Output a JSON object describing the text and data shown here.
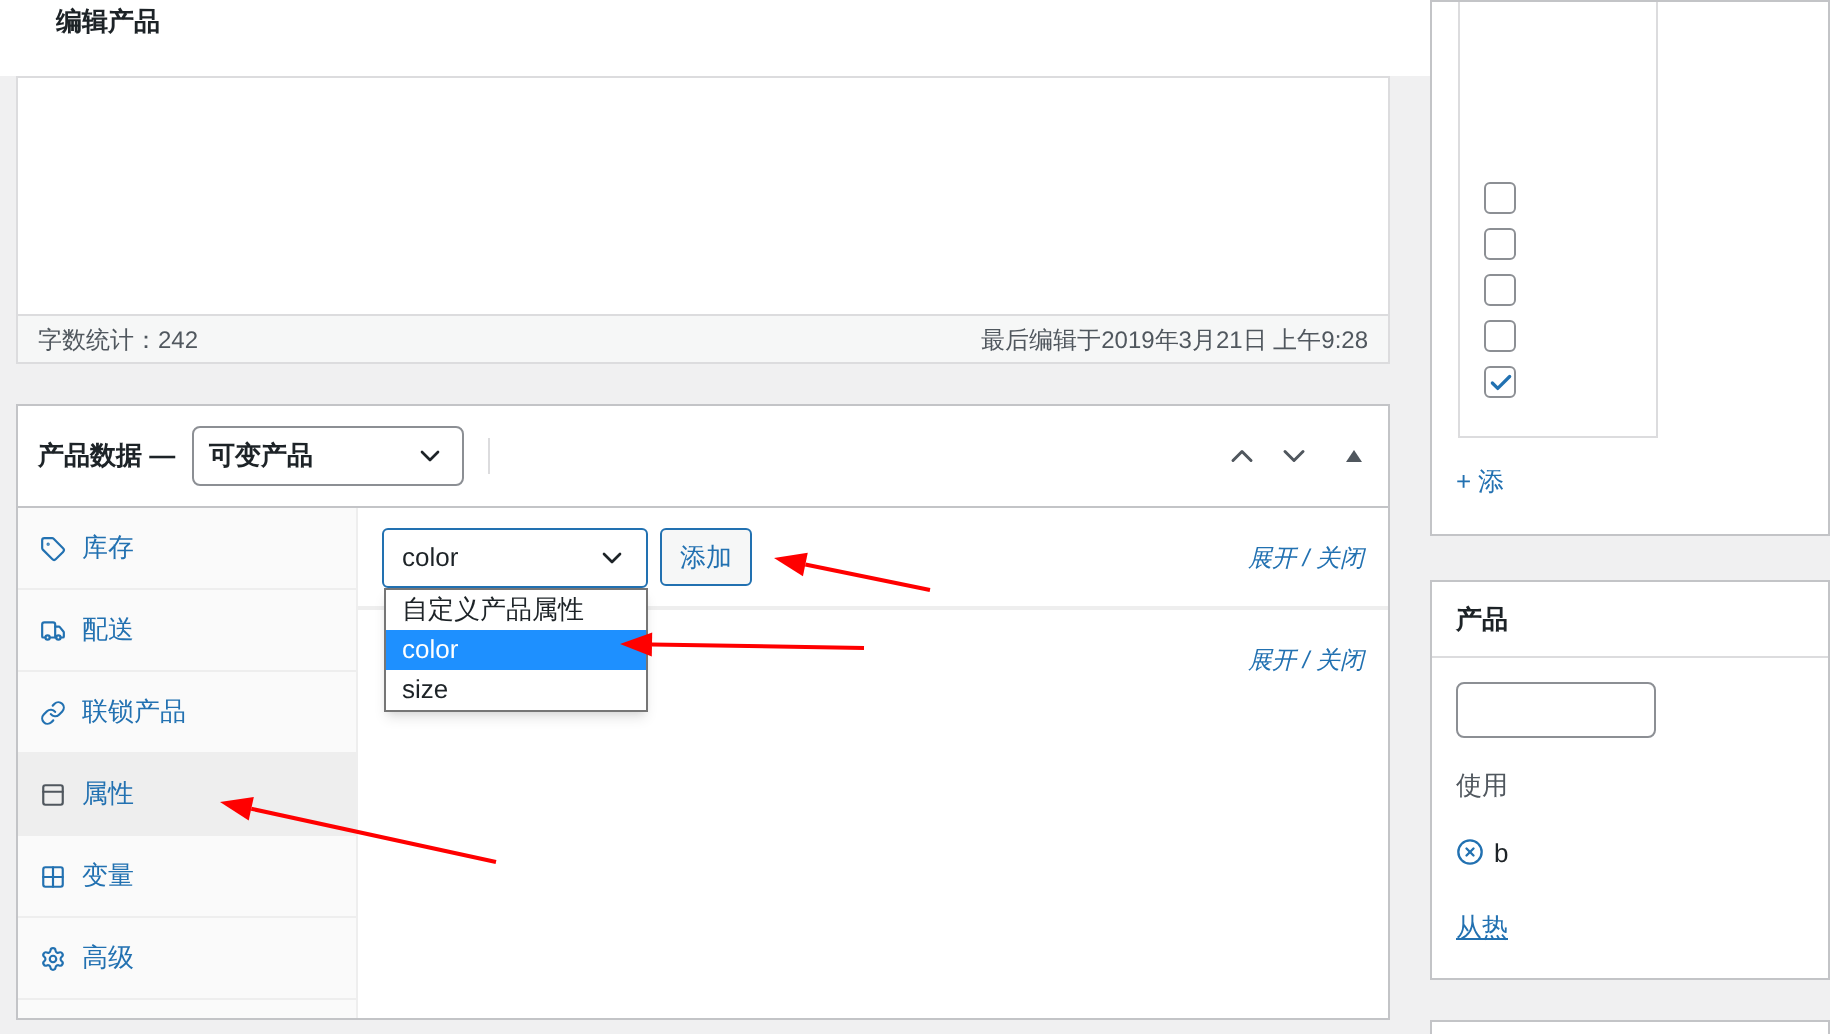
{
  "page_title": "编辑产品",
  "editor": {
    "word_count": "字数统计：242",
    "last_edited": "最后编辑于2019年3月21日 上午9:28"
  },
  "product_data": {
    "title": "产品数据 —",
    "type_select": {
      "value": "可变产品"
    },
    "tabs": [
      {
        "label": "库存",
        "selected": false
      },
      {
        "label": "配送",
        "selected": false
      },
      {
        "label": "联锁产品",
        "selected": false
      },
      {
        "label": "属性",
        "selected": true
      },
      {
        "label": "变量",
        "selected": false
      },
      {
        "label": "高级",
        "selected": false
      }
    ],
    "attribute_select": {
      "value": "color",
      "expanded": true,
      "options": [
        {
          "label": "自定义产品属性",
          "selected": false
        },
        {
          "label": "color",
          "selected": true
        },
        {
          "label": "size",
          "selected": false
        }
      ]
    },
    "add_button": "添加",
    "toggle_links": [
      "展开 / 关闭",
      "展开 / 关闭"
    ]
  },
  "sidebar": {
    "categories": {
      "checkboxes": [
        {
          "checked": false
        },
        {
          "checked": false
        },
        {
          "checked": false
        },
        {
          "checked": false
        },
        {
          "checked": true
        }
      ],
      "add_link": "+ 添"
    },
    "tags": {
      "title": "产品",
      "hint": "使用",
      "tags": [
        {
          "label": "b"
        }
      ],
      "popular_link": "从热"
    }
  }
}
